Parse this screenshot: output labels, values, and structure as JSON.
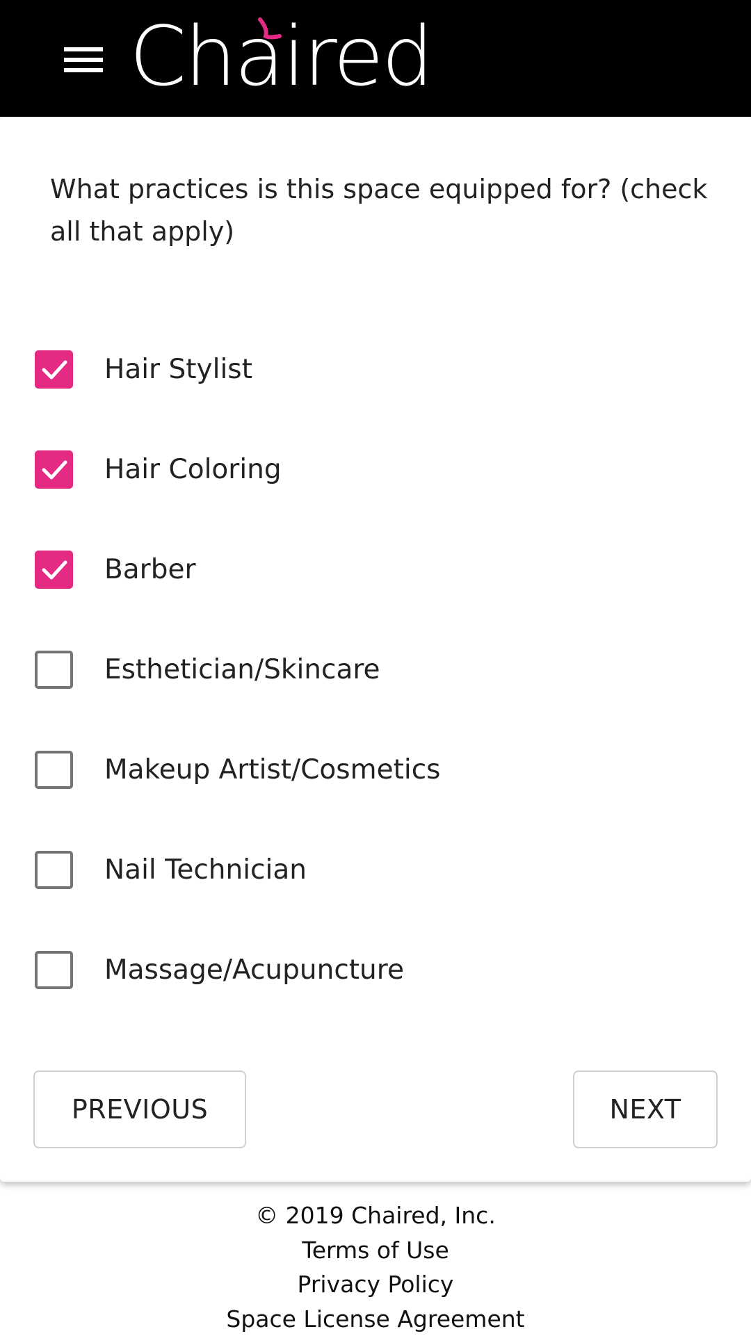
{
  "header": {
    "logo_text": "Chaired",
    "brand_color": "#e52a84",
    "menu_icon": "hamburger-menu-icon"
  },
  "form": {
    "question": "What practices is this space equipped for? (check all that apply)",
    "options": [
      {
        "label": "Hair Stylist",
        "checked": true
      },
      {
        "label": "Hair Coloring",
        "checked": true
      },
      {
        "label": "Barber",
        "checked": true
      },
      {
        "label": "Esthetician/Skincare",
        "checked": false
      },
      {
        "label": "Makeup Artist/Cosmetics",
        "checked": false
      },
      {
        "label": "Nail Technician",
        "checked": false
      },
      {
        "label": "Massage/Acupuncture",
        "checked": false
      }
    ],
    "previous_label": "PREVIOUS",
    "next_label": "NEXT",
    "checkbox_checked_color": "#e52a84",
    "checkbox_unchecked_color": "#757575"
  },
  "footer": {
    "copyright": "© 2019 Chaired, Inc.",
    "terms": "Terms of Use",
    "privacy": "Privacy Policy",
    "license": "Space License Agreement"
  }
}
